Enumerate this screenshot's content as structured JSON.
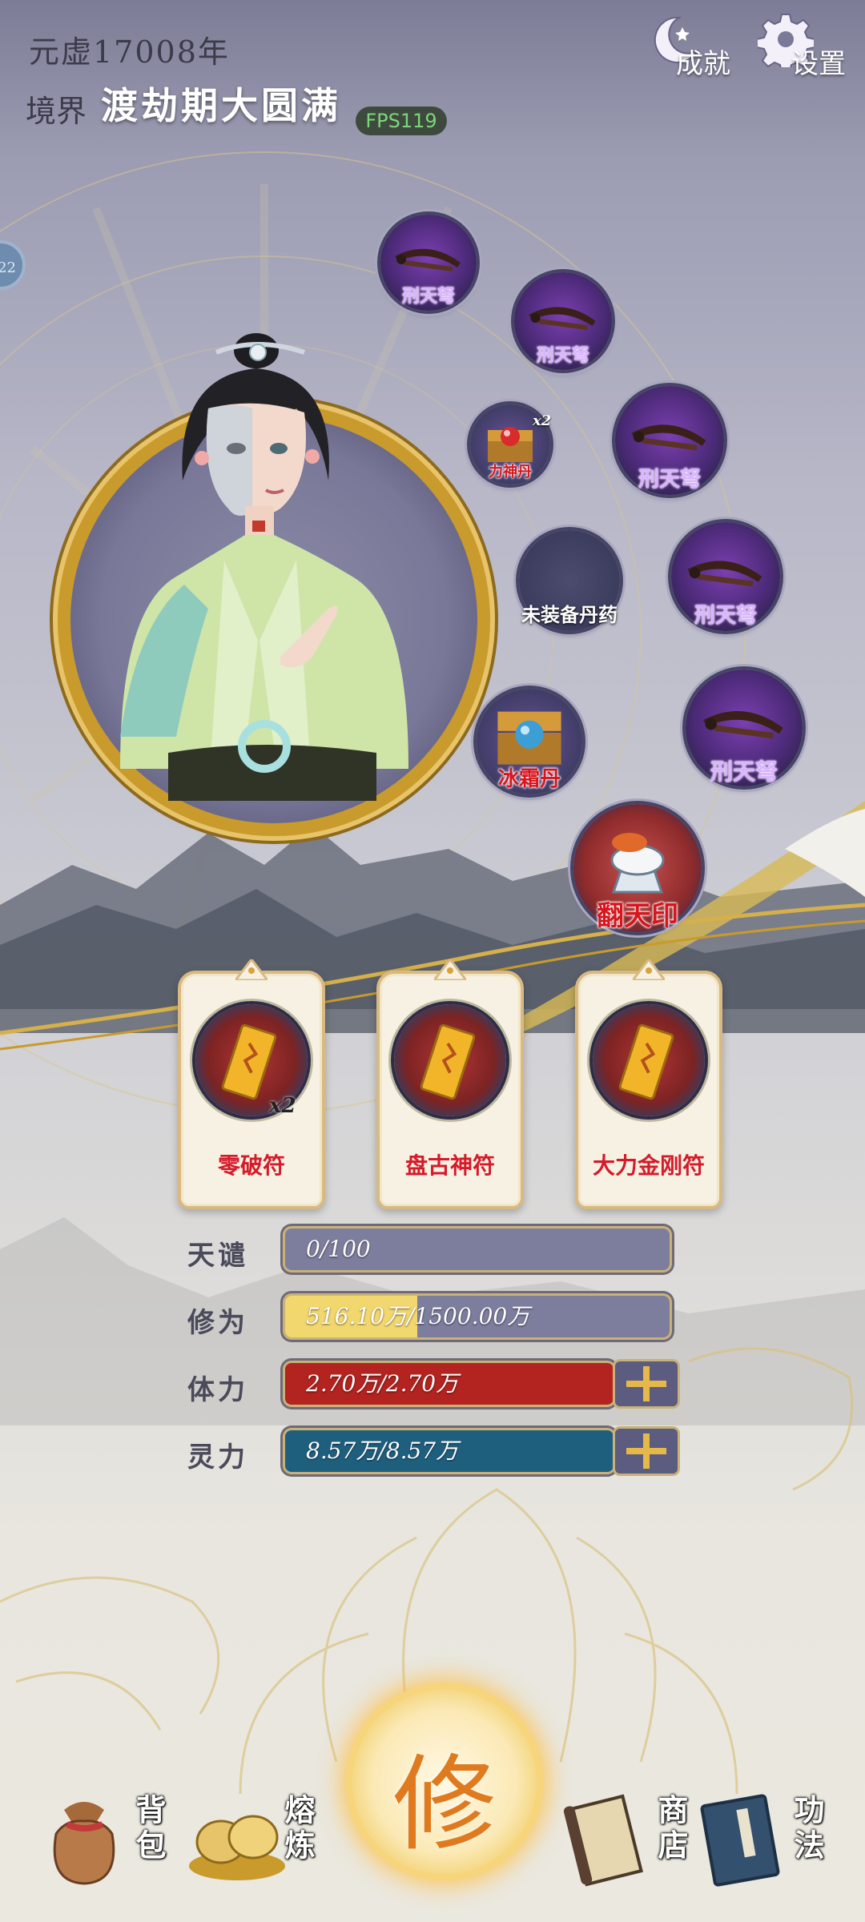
{
  "header": {
    "era": "元虚17008年",
    "realm_label": "境界",
    "realm_name": "渡劫期大圆满",
    "fps": "FPS119",
    "achievements_label": "成就",
    "settings_label": "设置",
    "side_tab": "22"
  },
  "equipment": {
    "empty_pill_label": "未装备丹药",
    "slots": [
      {
        "name": "刑天弩",
        "icon": "crossbow-icon"
      },
      {
        "name": "刑天弩",
        "icon": "crossbow-icon"
      },
      {
        "name": "力神丹",
        "icon": "treasure-chest-icon",
        "count": "x2"
      },
      {
        "name": "刑天弩",
        "icon": "crossbow-icon"
      },
      {
        "name": "刑天弩",
        "icon": "crossbow-icon"
      },
      {
        "name": "冰霜丹",
        "icon": "treasure-chest-icon"
      },
      {
        "name": "刑天弩",
        "icon": "crossbow-icon"
      },
      {
        "name": "翻天印",
        "icon": "seal-icon"
      }
    ]
  },
  "talismans": [
    {
      "name": "零破符",
      "count": "x2"
    },
    {
      "name": "盘古神符"
    },
    {
      "name": "大力金刚符"
    }
  ],
  "stats": {
    "heaven_tribulation": {
      "label": "天谴",
      "value": "0/100",
      "fill": 0
    },
    "cultivation": {
      "label": "修为",
      "value": "516.10万/1500.00万",
      "fill": 0.344
    },
    "stamina": {
      "label": "体力",
      "value": "2.70万/2.70万",
      "fill": 1
    },
    "spirit": {
      "label": "灵力",
      "value": "8.57万/8.57万",
      "fill": 1
    }
  },
  "nav": {
    "bag": "背包",
    "refine": "熔炼",
    "cultivate": "修",
    "shop": "商店",
    "skills": "功法"
  },
  "colors": {
    "gold": "#c99a2c",
    "stamina_red": "#b3231f",
    "spirit_teal": "#1f5f7e",
    "cultivation_yellow": "#f2d66e",
    "talisman_name_red": "#d51a2a"
  }
}
